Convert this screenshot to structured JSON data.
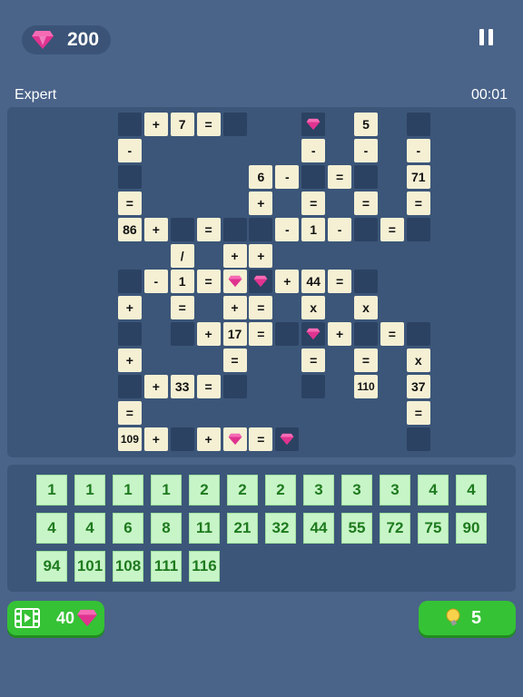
{
  "header": {
    "gems": "200"
  },
  "level": "Expert",
  "timer": "00:01",
  "colors": {
    "background": "#4a6389",
    "cell": "#f5f0d4",
    "blank": "#2c4262",
    "tile": "#c8f5c8",
    "tile_text": "#1e7a1e",
    "button": "#35c235",
    "gem": "#e0338f"
  },
  "board": [
    {
      "c": 1,
      "r": 0,
      "t": "d"
    },
    {
      "c": 2,
      "r": 0,
      "t": "l",
      "v": "+"
    },
    {
      "c": 3,
      "r": 0,
      "t": "l",
      "v": "7"
    },
    {
      "c": 4,
      "r": 0,
      "t": "l",
      "v": "="
    },
    {
      "c": 5,
      "r": 0,
      "t": "d"
    },
    {
      "c": 8,
      "r": 0,
      "t": "d",
      "g": true
    },
    {
      "c": 10,
      "r": 0,
      "t": "l",
      "v": "5"
    },
    {
      "c": 12,
      "r": 0,
      "t": "d"
    },
    {
      "c": 1,
      "r": 1,
      "t": "l",
      "v": "-"
    },
    {
      "c": 8,
      "r": 1,
      "t": "l",
      "v": "-"
    },
    {
      "c": 10,
      "r": 1,
      "t": "l",
      "v": "-"
    },
    {
      "c": 12,
      "r": 1,
      "t": "l",
      "v": "-"
    },
    {
      "c": 1,
      "r": 2,
      "t": "d"
    },
    {
      "c": 6,
      "r": 2,
      "t": "l",
      "v": "6"
    },
    {
      "c": 7,
      "r": 2,
      "t": "l",
      "v": "-"
    },
    {
      "c": 8,
      "r": 2,
      "t": "d"
    },
    {
      "c": 9,
      "r": 2,
      "t": "l",
      "v": "="
    },
    {
      "c": 10,
      "r": 2,
      "t": "d"
    },
    {
      "c": 12,
      "r": 2,
      "t": "l",
      "v": "71"
    },
    {
      "c": 1,
      "r": 3,
      "t": "l",
      "v": "="
    },
    {
      "c": 6,
      "r": 3,
      "t": "l",
      "v": "+"
    },
    {
      "c": 8,
      "r": 3,
      "t": "l",
      "v": "="
    },
    {
      "c": 10,
      "r": 3,
      "t": "l",
      "v": "="
    },
    {
      "c": 12,
      "r": 3,
      "t": "l",
      "v": "="
    },
    {
      "c": 1,
      "r": 4,
      "t": "l",
      "v": "86"
    },
    {
      "c": 2,
      "r": 4,
      "t": "l",
      "v": "+"
    },
    {
      "c": 3,
      "r": 4,
      "t": "d"
    },
    {
      "c": 4,
      "r": 4,
      "t": "l",
      "v": "="
    },
    {
      "c": 5,
      "r": 4,
      "t": "d"
    },
    {
      "c": 6,
      "r": 4,
      "t": "d"
    },
    {
      "c": 7,
      "r": 4,
      "t": "l",
      "v": "-"
    },
    {
      "c": 8,
      "r": 4,
      "t": "l",
      "v": "1"
    },
    {
      "c": 9,
      "r": 4,
      "t": "l",
      "v": "-"
    },
    {
      "c": 10,
      "r": 4,
      "t": "d"
    },
    {
      "c": 11,
      "r": 4,
      "t": "l",
      "v": "="
    },
    {
      "c": 12,
      "r": 4,
      "t": "d"
    },
    {
      "c": 3,
      "r": 5,
      "t": "l",
      "v": "/"
    },
    {
      "c": 5,
      "r": 5,
      "t": "l",
      "v": "+"
    },
    {
      "c": 6,
      "r": 5,
      "t": "l",
      "v": "+"
    },
    {
      "c": 1,
      "r": 6,
      "t": "d"
    },
    {
      "c": 2,
      "r": 6,
      "t": "l",
      "v": "-"
    },
    {
      "c": 3,
      "r": 6,
      "t": "l",
      "v": "1"
    },
    {
      "c": 4,
      "r": 6,
      "t": "l",
      "v": "="
    },
    {
      "c": 5,
      "r": 6,
      "t": "l",
      "g": true
    },
    {
      "c": 6,
      "r": 6,
      "t": "d",
      "g": true
    },
    {
      "c": 7,
      "r": 6,
      "t": "l",
      "v": "+"
    },
    {
      "c": 8,
      "r": 6,
      "t": "l",
      "v": "44"
    },
    {
      "c": 9,
      "r": 6,
      "t": "l",
      "v": "="
    },
    {
      "c": 10,
      "r": 6,
      "t": "d"
    },
    {
      "c": 1,
      "r": 7,
      "t": "l",
      "v": "+"
    },
    {
      "c": 3,
      "r": 7,
      "t": "l",
      "v": "="
    },
    {
      "c": 5,
      "r": 7,
      "t": "l",
      "v": "+"
    },
    {
      "c": 6,
      "r": 7,
      "t": "l",
      "v": "="
    },
    {
      "c": 8,
      "r": 7,
      "t": "l",
      "v": "x"
    },
    {
      "c": 10,
      "r": 7,
      "t": "l",
      "v": "x"
    },
    {
      "c": 1,
      "r": 8,
      "t": "d"
    },
    {
      "c": 3,
      "r": 8,
      "t": "d"
    },
    {
      "c": 4,
      "r": 8,
      "t": "l",
      "v": "+"
    },
    {
      "c": 5,
      "r": 8,
      "t": "l",
      "v": "17"
    },
    {
      "c": 6,
      "r": 8,
      "t": "l",
      "v": "="
    },
    {
      "c": 7,
      "r": 8,
      "t": "d"
    },
    {
      "c": 8,
      "r": 8,
      "t": "d",
      "g": true
    },
    {
      "c": 9,
      "r": 8,
      "t": "l",
      "v": "+"
    },
    {
      "c": 10,
      "r": 8,
      "t": "d"
    },
    {
      "c": 11,
      "r": 8,
      "t": "l",
      "v": "="
    },
    {
      "c": 12,
      "r": 8,
      "t": "d"
    },
    {
      "c": 1,
      "r": 9,
      "t": "l",
      "v": "+"
    },
    {
      "c": 5,
      "r": 9,
      "t": "l",
      "v": "="
    },
    {
      "c": 8,
      "r": 9,
      "t": "l",
      "v": "="
    },
    {
      "c": 10,
      "r": 9,
      "t": "l",
      "v": "="
    },
    {
      "c": 12,
      "r": 9,
      "t": "l",
      "v": "x"
    },
    {
      "c": 1,
      "r": 10,
      "t": "d"
    },
    {
      "c": 2,
      "r": 10,
      "t": "l",
      "v": "+"
    },
    {
      "c": 3,
      "r": 10,
      "t": "l",
      "v": "33"
    },
    {
      "c": 4,
      "r": 10,
      "t": "l",
      "v": "="
    },
    {
      "c": 5,
      "r": 10,
      "t": "d"
    },
    {
      "c": 8,
      "r": 10,
      "t": "d"
    },
    {
      "c": 10,
      "r": 10,
      "t": "l",
      "v": "110"
    },
    {
      "c": 12,
      "r": 10,
      "t": "l",
      "v": "37"
    },
    {
      "c": 1,
      "r": 11,
      "t": "l",
      "v": "="
    },
    {
      "c": 12,
      "r": 11,
      "t": "l",
      "v": "="
    },
    {
      "c": 1,
      "r": 12,
      "t": "l",
      "v": "109"
    },
    {
      "c": 2,
      "r": 12,
      "t": "l",
      "v": "+"
    },
    {
      "c": 3,
      "r": 12,
      "t": "d"
    },
    {
      "c": 4,
      "r": 12,
      "t": "l",
      "v": "+"
    },
    {
      "c": 5,
      "r": 12,
      "t": "l",
      "g": true
    },
    {
      "c": 6,
      "r": 12,
      "t": "l",
      "v": "="
    },
    {
      "c": 7,
      "r": 12,
      "t": "d",
      "g": true
    },
    {
      "c": 12,
      "r": 12,
      "t": "d"
    }
  ],
  "tiles": [
    "1",
    "1",
    "1",
    "1",
    "2",
    "2",
    "2",
    "3",
    "3",
    "3",
    "4",
    "4",
    "4",
    "4",
    "6",
    "8",
    "11",
    "21",
    "32",
    "44",
    "55",
    "72",
    "75",
    "90",
    "94",
    "101",
    "108",
    "111",
    "116"
  ],
  "buttons": {
    "video_cost": "40",
    "hint_count": "5"
  }
}
